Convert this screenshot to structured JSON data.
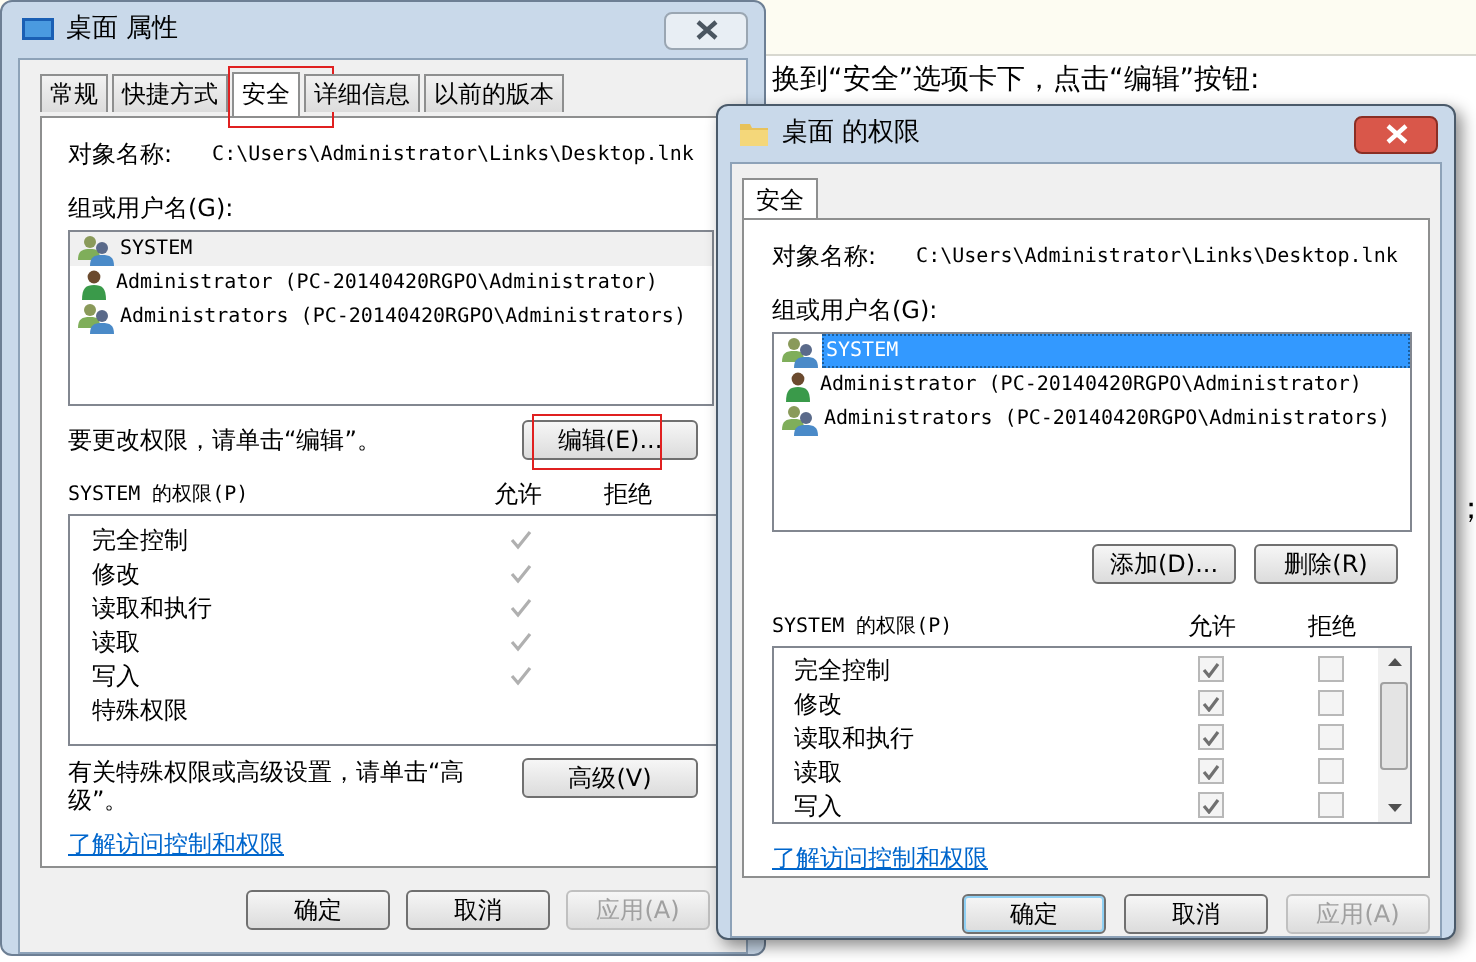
{
  "page": {
    "instruction": "换到“安全”选项卡下，点击“编辑”按钮:",
    "side_marks": [
      "；"
    ]
  },
  "properties_dialog": {
    "title": "桌面 属性",
    "tabs": [
      {
        "label": "常规",
        "selected": false,
        "highlighted": false
      },
      {
        "label": "快捷方式",
        "selected": false,
        "highlighted": false
      },
      {
        "label": "安全",
        "selected": true,
        "highlighted": true
      },
      {
        "label": "详细信息",
        "selected": false,
        "highlighted": false
      },
      {
        "label": "以前的版本",
        "selected": false,
        "highlighted": false
      }
    ],
    "object_label": "对象名称:",
    "object_path": "C:\\Users\\Administrator\\Links\\Desktop.lnk",
    "groups_label": "组或用户名(G):",
    "users": [
      {
        "name": "SYSTEM",
        "kind": "group",
        "selected": true
      },
      {
        "name": "Administrator (PC-20140420RGPO\\Administrator)",
        "kind": "user",
        "selected": false
      },
      {
        "name": "Administrators (PC-20140420RGPO\\Administrators)",
        "kind": "group",
        "selected": false
      }
    ],
    "edit_hint": "要更改权限，请单击“编辑”。",
    "edit_button": {
      "label": "编辑(E)...",
      "highlighted": true
    },
    "permissions_label": "SYSTEM 的权限(P)",
    "allow_header": "允许",
    "deny_header": "拒绝",
    "permissions": [
      {
        "name": "完全控制",
        "allow": true
      },
      {
        "name": "修改",
        "allow": true
      },
      {
        "name": "读取和执行",
        "allow": true
      },
      {
        "name": "读取",
        "allow": true
      },
      {
        "name": "写入",
        "allow": true
      },
      {
        "name": "特殊权限",
        "allow": false
      }
    ],
    "advanced_hint": "有关特殊权限或高级设置，请单击“高级”。",
    "advanced_button": "高级(V)",
    "link": "了解访问控制和权限",
    "buttons": [
      {
        "label": "确定",
        "disabled": false
      },
      {
        "label": "取消",
        "disabled": false
      },
      {
        "label": "应用(A)",
        "disabled": true
      }
    ]
  },
  "permission_dialog": {
    "title": "桌面 的权限",
    "tab": "安全",
    "object_label": "对象名称:",
    "object_path": "C:\\Users\\Administrator\\Links\\Desktop.lnk",
    "groups_label": "组或用户名(G):",
    "users": [
      {
        "name": "SYSTEM",
        "kind": "group",
        "selected": true
      },
      {
        "name": "Administrator (PC-20140420RGPO\\Administrator)",
        "kind": "user",
        "selected": false
      },
      {
        "name": "Administrators (PC-20140420RGPO\\Administrators)",
        "kind": "group",
        "selected": false
      }
    ],
    "add_button": "添加(D)...",
    "remove_button": "删除(R)",
    "permissions_label": "SYSTEM 的权限(P)",
    "allow_header": "允许",
    "deny_header": "拒绝",
    "permissions": [
      {
        "name": "完全控制",
        "allow": true,
        "deny": false
      },
      {
        "name": "修改",
        "allow": true,
        "deny": false
      },
      {
        "name": "读取和执行",
        "allow": true,
        "deny": false
      },
      {
        "name": "读取",
        "allow": true,
        "deny": false
      },
      {
        "name": "写入",
        "allow": true,
        "deny": false
      }
    ],
    "link": "了解访问控制和权限",
    "buttons": [
      {
        "label": "确定",
        "disabled": false,
        "default": true
      },
      {
        "label": "取消",
        "disabled": false,
        "default": false
      },
      {
        "label": "应用(A)",
        "disabled": true,
        "default": false
      }
    ]
  }
}
